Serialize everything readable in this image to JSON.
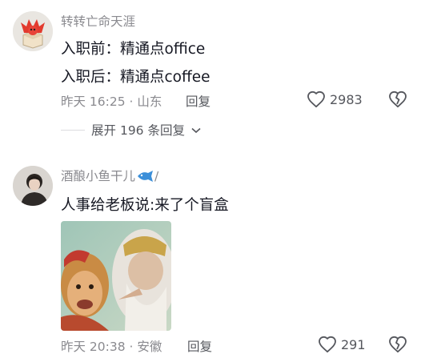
{
  "comments": [
    {
      "username": "转转亡命天涯",
      "lines": [
        "入职前：精通点office",
        "入职后：精通点coffee"
      ],
      "time": "昨天 16:25",
      "location": "山东",
      "reply_label": "回复",
      "like_count": "2983",
      "expand": {
        "prefix": "展开",
        "count": "196",
        "suffix": "条回复"
      },
      "icons": [
        "avatar",
        "heart-icon",
        "dislike-icon",
        "chevron-down-icon"
      ]
    },
    {
      "username": "酒酿小鱼干儿",
      "username_suffix": "/",
      "lines": [
        "人事给老板说:来了个盲盒"
      ],
      "time": "昨天 20:38",
      "location": "安徽",
      "reply_label": "回复",
      "like_count": "291",
      "icons": [
        "avatar",
        "fish-icon",
        "picture",
        "heart-icon",
        "dislike-icon"
      ]
    }
  ],
  "colors": {
    "text": "#161823",
    "secondary": "#8a8a8f",
    "action": "#55575d",
    "divider": "#dcdcdf"
  }
}
